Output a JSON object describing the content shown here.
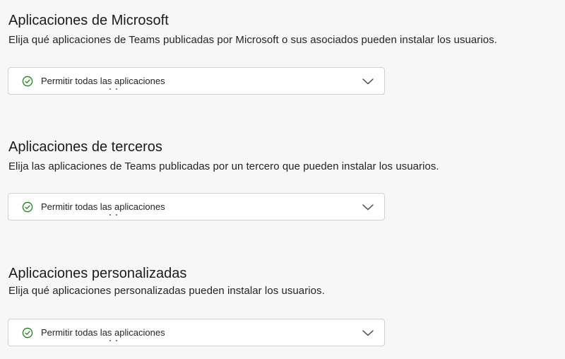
{
  "sections": [
    {
      "title": "Aplicaciones de Microsoft",
      "description": "Elija qué aplicaciones de Teams publicadas por Microsoft o sus asociados pueden instalar los usuarios.",
      "dropdown": {
        "selected": "Permitir todas las aplicaciones",
        "icon": "check-circle-icon"
      }
    },
    {
      "title": "Aplicaciones de terceros",
      "description": "Elija las aplicaciones de Teams publicadas por un tercero que pueden instalar los usuarios.",
      "dropdown": {
        "selected": "Permitir todas las aplicaciones",
        "icon": "check-circle-icon"
      }
    },
    {
      "title": "Aplicaciones personalizadas",
      "description": "Elija qué aplicaciones personalizadas pueden instalar los usuarios.",
      "dropdown": {
        "selected": "Permitir todas las aplicaciones",
        "icon": "check-circle-icon"
      }
    }
  ],
  "colors": {
    "check_icon": "#107c10",
    "chevron": "#424242",
    "border": "#d1d1d1",
    "background": "#f7f7f7"
  }
}
